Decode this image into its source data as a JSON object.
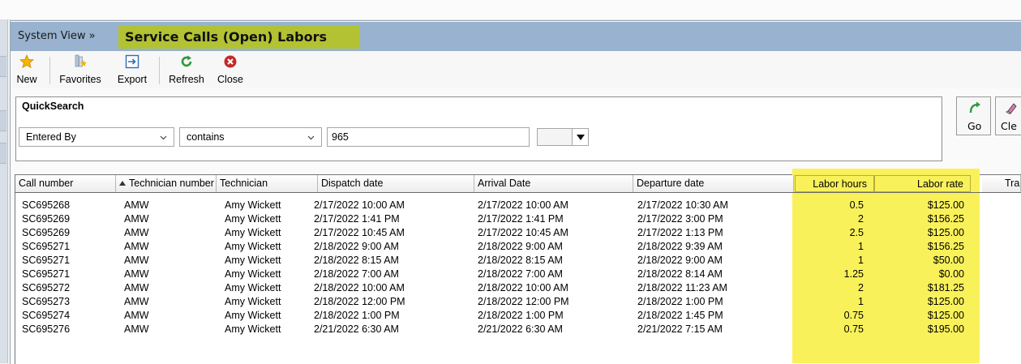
{
  "breadcrumb": "System View »",
  "page_title": "Service Calls (Open) Labors",
  "toolbar": [
    {
      "label": "New",
      "icon": "star-icon"
    },
    {
      "label": "Favorites",
      "icon": "favorites-icon"
    },
    {
      "label": "Export",
      "icon": "export-icon"
    },
    {
      "label": "Refresh",
      "icon": "refresh-icon"
    },
    {
      "label": "Close",
      "icon": "close-icon"
    }
  ],
  "quicksearch": {
    "title": "QuickSearch",
    "field": "Entered By",
    "operator": "contains",
    "value": "965",
    "go_label": "Go",
    "clear_label": "Cle"
  },
  "grid": {
    "columns": [
      "Call number",
      "Technician number",
      "Technician",
      "Dispatch date",
      "Arrival Date",
      "Departure date",
      "Labor hours",
      "Labor rate",
      "Tra"
    ],
    "sorted_column": "Call number",
    "highlight_color": "#f9f15a",
    "rows": [
      [
        "SC695268",
        "AMW",
        "Amy Wickett",
        "2/17/2022 10:00 AM",
        "2/17/2022 10:00 AM",
        "2/17/2022 10:30 AM",
        "0.5",
        "$125.00"
      ],
      [
        "SC695269",
        "AMW",
        "Amy Wickett",
        "2/17/2022 1:41 PM",
        "2/17/2022 1:41 PM",
        "2/17/2022 3:00 PM",
        "2",
        "$156.25"
      ],
      [
        "SC695269",
        "AMW",
        "Amy Wickett",
        "2/17/2022 10:45 AM",
        "2/17/2022 10:45 AM",
        "2/17/2022 1:13 PM",
        "2.5",
        "$125.00"
      ],
      [
        "SC695271",
        "AMW",
        "Amy Wickett",
        "2/18/2022 9:00 AM",
        "2/18/2022 9:00 AM",
        "2/18/2022 9:39 AM",
        "1",
        "$156.25"
      ],
      [
        "SC695271",
        "AMW",
        "Amy Wickett",
        "2/18/2022 8:15 AM",
        "2/18/2022 8:15 AM",
        "2/18/2022 9:00 AM",
        "1",
        "$50.00"
      ],
      [
        "SC695271",
        "AMW",
        "Amy Wickett",
        "2/18/2022 7:00 AM",
        "2/18/2022 7:00 AM",
        "2/18/2022 8:14 AM",
        "1.25",
        "$0.00"
      ],
      [
        "SC695272",
        "AMW",
        "Amy Wickett",
        "2/18/2022 10:00 AM",
        "2/18/2022 10:00 AM",
        "2/18/2022 11:23 AM",
        "2",
        "$181.25"
      ],
      [
        "SC695273",
        "AMW",
        "Amy Wickett",
        "2/18/2022 12:00 PM",
        "2/18/2022 12:00 PM",
        "2/18/2022 1:00 PM",
        "1",
        "$125.00"
      ],
      [
        "SC695274",
        "AMW",
        "Amy Wickett",
        "2/18/2022 1:00 PM",
        "2/18/2022 1:00 PM",
        "2/18/2022 1:45 PM",
        "0.75",
        "$125.00"
      ],
      [
        "SC695276",
        "AMW",
        "Amy Wickett",
        "2/21/2022 6:30 AM",
        "2/21/2022 6:30 AM",
        "2/21/2022 7:15 AM",
        "0.75",
        "$195.00"
      ]
    ]
  }
}
